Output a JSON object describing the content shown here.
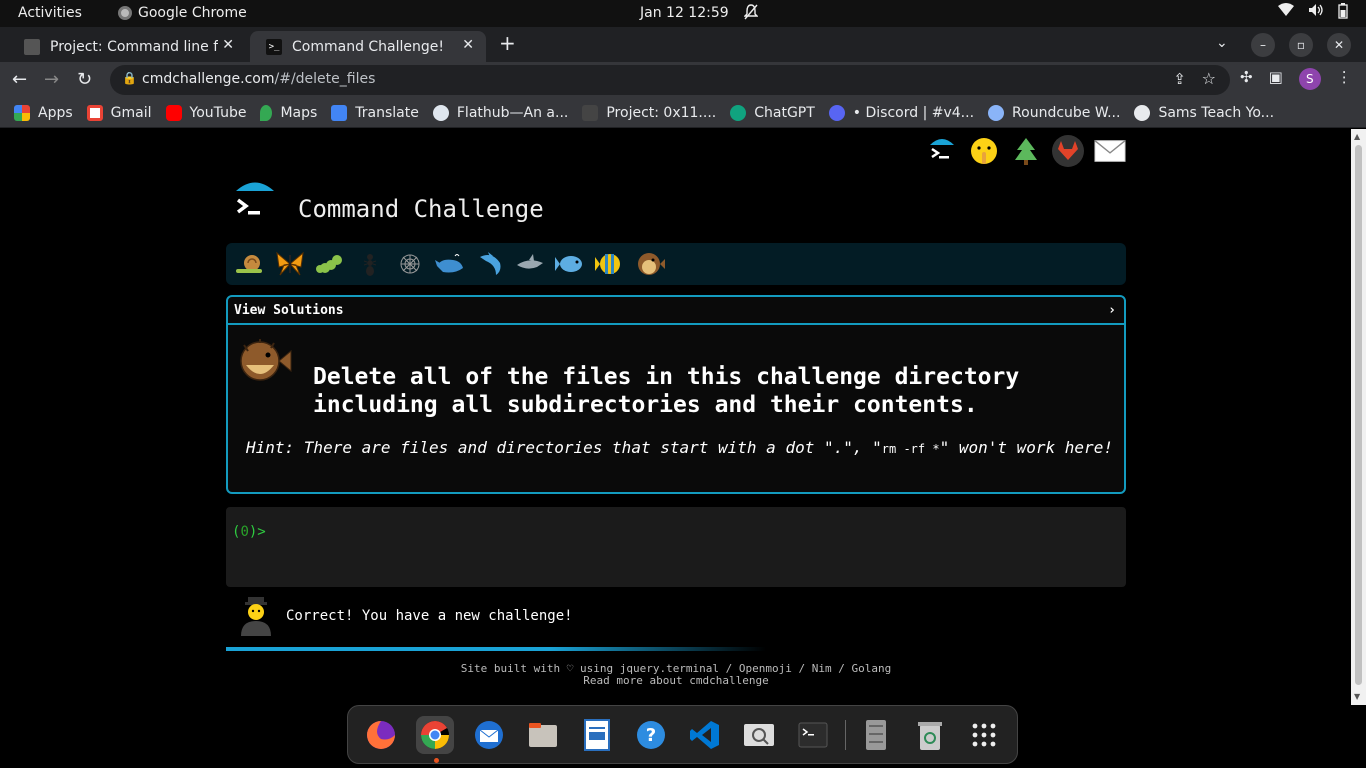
{
  "topbar": {
    "activities": "Activities",
    "app": "Google Chrome",
    "clock": "Jan 12  12:59"
  },
  "tabs": [
    {
      "title": "Project: Command line for"
    },
    {
      "title": "Command Challenge!"
    }
  ],
  "toolbar": {
    "url_host": "cmdchallenge.com",
    "url_path": "/#/delete_files",
    "profile_initial": "S"
  },
  "bookmarks": [
    {
      "label": "Apps",
      "icon": "apps-grid-icon",
      "color": "#ea4335"
    },
    {
      "label": "Gmail",
      "icon": "gmail-icon",
      "color": "#ea4335"
    },
    {
      "label": "YouTube",
      "icon": "youtube-icon",
      "color": "#ff0000"
    },
    {
      "label": "Maps",
      "icon": "maps-icon",
      "color": "#34a853"
    },
    {
      "label": "Translate",
      "icon": "translate-icon",
      "color": "#4285f4"
    },
    {
      "label": "Flathub—An a...",
      "icon": "flathub-icon",
      "color": "#dfe6ee"
    },
    {
      "label": "Project: 0x11....",
      "icon": "project-icon",
      "color": "#444444"
    },
    {
      "label": "ChatGPT",
      "icon": "chatgpt-icon",
      "color": "#10a37f"
    },
    {
      "label": "• Discord | #v4...",
      "icon": "discord-icon",
      "color": "#5865f2"
    },
    {
      "label": "Roundcube W...",
      "icon": "roundcube-icon",
      "color": "#8ab4f8"
    },
    {
      "label": "Sams Teach Yo...",
      "icon": "globe-icon",
      "color": "#e8eaed"
    }
  ],
  "site": {
    "title": "Command Challenge",
    "view_solutions": "View Solutions",
    "chevron": "›",
    "task_line1": "Delete all of the files in this challenge directory",
    "task_line2": "including all subdirectories and their contents.",
    "hint_pre": "Hint: There are files and directories that start with a dot \".\", \"",
    "hint_code": "rm -rf *",
    "hint_post": "\" won't work here!",
    "prompt_open": "(",
    "prompt_num": "0",
    "prompt_close": ")>",
    "success_msg": "Correct! You have a new challenge!",
    "footer_line1": "Site built with ♡ using jquery.terminal / Openmoji / Nim / Golang",
    "footer_line2": "Read more about cmdchallenge",
    "progress_fraction": 0.6,
    "accent_color": "#139bbf"
  },
  "level_icons": [
    "snail-icon",
    "butterfly-icon",
    "caterpillar-icon",
    "ant-icon",
    "spider-web-icon",
    "whale-icon",
    "dolphin-icon",
    "shark-icon",
    "fish-icon",
    "tropical-fish-icon",
    "blowfish-icon"
  ],
  "dock": [
    "firefox-icon",
    "chrome-icon",
    "thunderbird-icon",
    "files-icon",
    "writer-icon",
    "help-icon",
    "vscode-icon",
    "screenshot-icon",
    "terminal-icon",
    "disks-icon",
    "trash-icon",
    "show-apps-icon"
  ]
}
